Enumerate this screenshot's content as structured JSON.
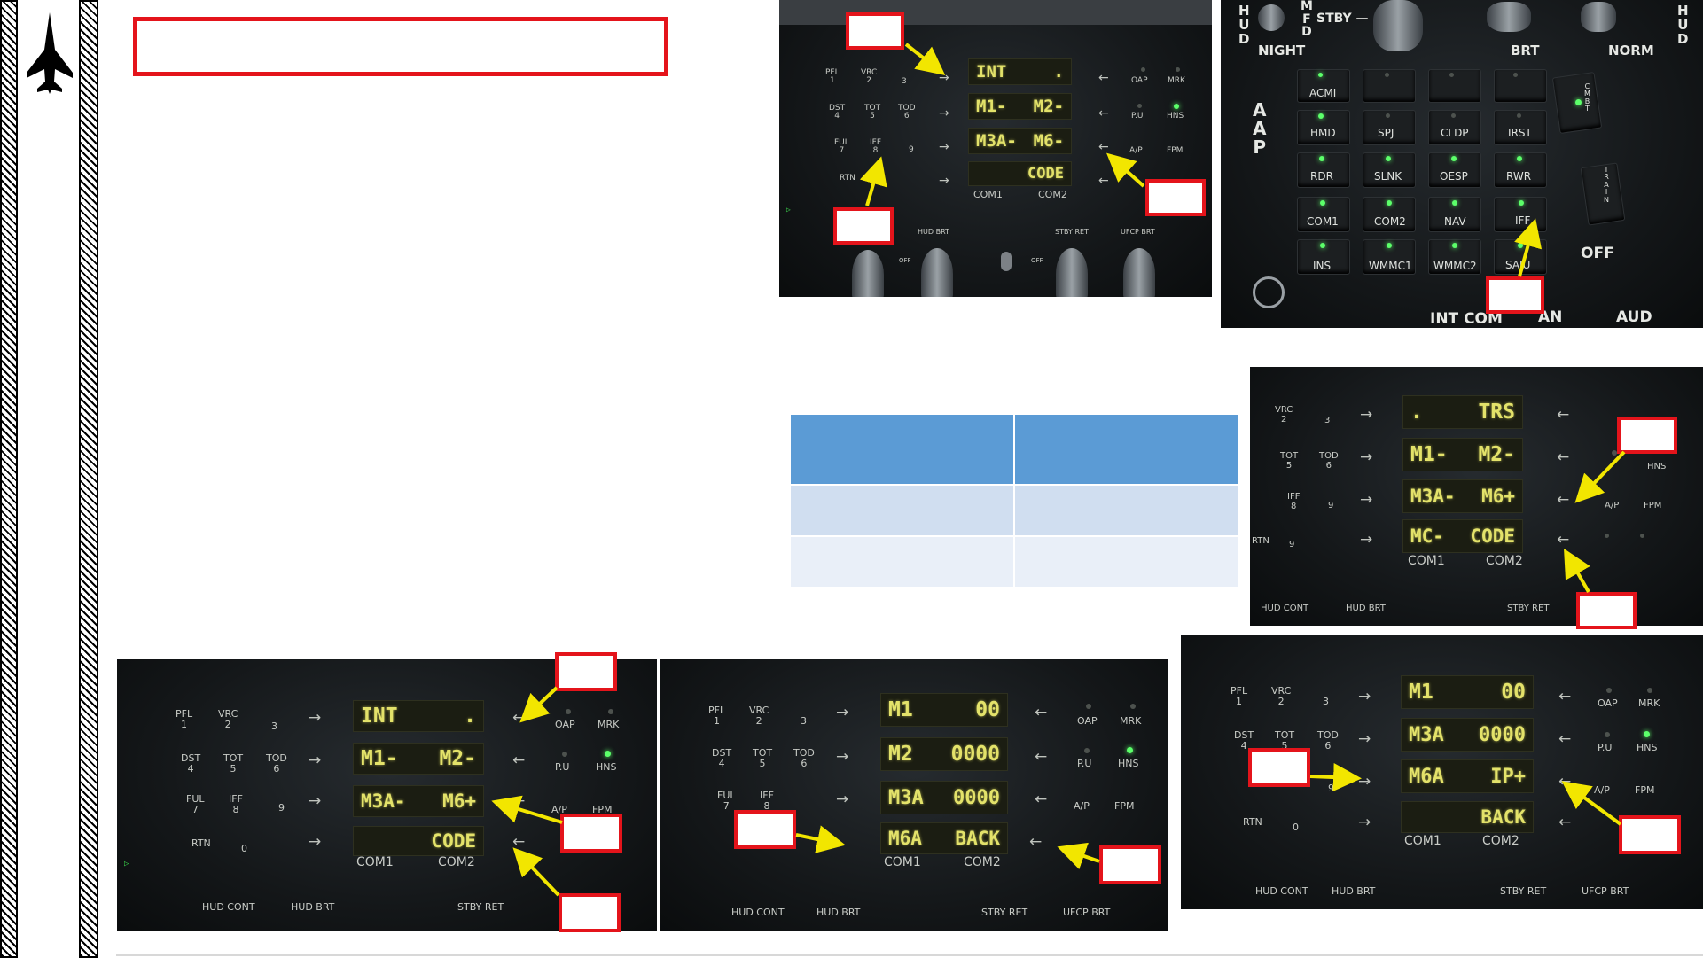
{
  "sidebar": {
    "icon": "fighter-jet-icon"
  },
  "colors": {
    "callout_red": "#e4141b",
    "arrow_yellow": "#f2e600",
    "lcd_text": "#e3e26a",
    "led_green": "#5cff6a",
    "table_header": "#5b9bd5",
    "table_row1": "#d0def0",
    "table_row2": "#e9eff8"
  },
  "ufc_labels": {
    "pfl": "PFL\n1",
    "vrc": "VRC\n2",
    "k3": "3",
    "dst": "DST\n4",
    "tot": "TOT\n5",
    "tod": "TOD\n6",
    "ful": "FUL\n7",
    "iff": "IFF\n8",
    "k9": "9",
    "rtn": "RTN",
    "k0": "0",
    "oap": "OAP",
    "mrk": "MRK",
    "pu": "P.U",
    "hns": "HNS",
    "ap": "A/P",
    "fpm": "FPM",
    "com1": "COM1",
    "com2": "COM2",
    "hud_brt": "HUD BRT",
    "hud_cont": "HUD CONT",
    "stby_ret": "STBY RET",
    "ufcp_brt": "UFCP BRT",
    "off": "OFF"
  },
  "panel_top": {
    "lines": [
      {
        "left": "INT",
        "right": "."
      },
      {
        "left": "M1-",
        "right": "M2-"
      },
      {
        "left": "M3A-",
        "right": "M6-"
      },
      {
        "left": "",
        "right": "CODE"
      }
    ]
  },
  "aap": {
    "title": "A\nA\nP",
    "top_labels": {
      "hud": "H\nU\nD",
      "mfd": "M\nF\nD",
      "stby": "STBY —",
      "hud2": "H\nU\nD",
      "night": "NIGHT",
      "brt": "BRT",
      "norm": "NORM"
    },
    "buttons": [
      "ACMI",
      "",
      "",
      "",
      "HMD",
      "SPJ",
      "CLDP",
      "IRST",
      "RDR",
      "SLNK",
      "OESP",
      "RWR",
      "COM1",
      "COM2",
      "NAV",
      "IFF",
      "INS",
      "WMMC1",
      "WMMC2",
      "SAIU"
    ],
    "side": {
      "cmbt": "C\nM\nB\nT",
      "train": "T\nR\nA\nI\nN",
      "off": "OFF"
    },
    "bottom": [
      "INT COM",
      "AN",
      "AUD"
    ]
  },
  "panel_trs": {
    "lines": [
      {
        "left": ".",
        "right": "TRS"
      },
      {
        "left": "M1-",
        "right": "M2-"
      },
      {
        "left": "M3A-",
        "right": "M6+"
      },
      {
        "left": "MC-",
        "right": "CODE"
      }
    ]
  },
  "panel_bl": {
    "lines": [
      {
        "left": "INT",
        "right": "."
      },
      {
        "left": "M1-",
        "right": "M2-"
      },
      {
        "left": "M3A-",
        "right": "M6+"
      },
      {
        "left": "",
        "right": "CODE"
      }
    ]
  },
  "panel_bm": {
    "lines": [
      {
        "left": "M1",
        "right": "00"
      },
      {
        "left": "M2",
        "right": "0000"
      },
      {
        "left": "M3A",
        "right": "0000"
      },
      {
        "left": "M6A",
        "right": "BACK"
      }
    ]
  },
  "panel_br": {
    "lines": [
      {
        "left": "M1",
        "right": "00"
      },
      {
        "left": "M3A",
        "right": "0000"
      },
      {
        "left": "M6A",
        "right": "IP+"
      },
      {
        "left": "",
        "right": "BACK"
      }
    ]
  }
}
